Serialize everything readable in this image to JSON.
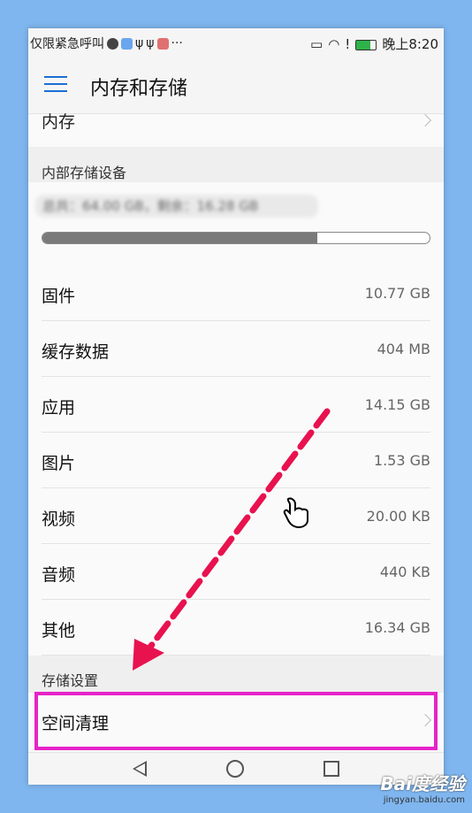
{
  "status_bar": {
    "carrier": "仅限紧急呼叫",
    "time": "晚上8:20"
  },
  "app_bar": {
    "title": "内存和存储"
  },
  "memory_row": {
    "label": "内存"
  },
  "internal_storage": {
    "header": "内部存储设备",
    "summary_blurred": "总共：64.00 GB，剩余：16.28 GB",
    "used_fraction": 0.71
  },
  "items": [
    {
      "label": "固件",
      "value": "10.77 GB"
    },
    {
      "label": "缓存数据",
      "value": "404 MB"
    },
    {
      "label": "应用",
      "value": "14.15 GB"
    },
    {
      "label": "图片",
      "value": "1.53 GB"
    },
    {
      "label": "视频",
      "value": "20.00 KB"
    },
    {
      "label": "音频",
      "value": "440 KB"
    },
    {
      "label": "其他",
      "value": "16.34 GB"
    }
  ],
  "storage_settings": {
    "header": "存储设置",
    "clean_label": "空间清理"
  },
  "watermark": {
    "brand": "Bai度经验",
    "url": "jingyan.baidu.com"
  },
  "colors": {
    "accent": "#1a6fd4",
    "highlight": "#e623c8",
    "arrow": "#e8124f"
  }
}
